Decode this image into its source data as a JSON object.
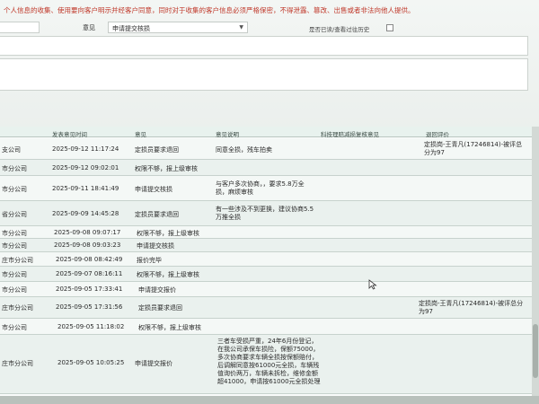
{
  "notice": "个人信息的收集、使用要向客户明示并经客户同意，同时对于收集的客户信息必须严格保密，不得泄露、篡改、出售或者非法向他人提供。",
  "filter": {
    "yijian_label": "意见",
    "yijian_value": "申请提交核损",
    "history_label": "是否已读/查看过往历史"
  },
  "table": {
    "headers": [
      "",
      "发表意见时间",
      "意见",
      "意见说明",
      "科技理赔减损复核意见",
      "退回评价"
    ],
    "rows": [
      {
        "org": "支公司",
        "time": "2025-09-12 11:17:24",
        "opinion": "定损员要求退回",
        "desc": "同意全损，残车拍卖",
        "review": "",
        "eval": "定损岗-王青凡(17246814)-被评总分为97"
      },
      {
        "org": "市分公司",
        "time": "2025-09-12 09:02:01",
        "opinion": "权限不够，报上级审核",
        "desc": "",
        "review": "",
        "eval": ""
      },
      {
        "org": "市分公司",
        "time": "2025-09-11 18:41:49",
        "opinion": "申请提交核损",
        "desc": "与客户多次协商，，要求5.8万全损，麻烦审核",
        "review": "",
        "eval": ""
      },
      {
        "org": "省分公司",
        "time": "2025-09-09 14:45:28",
        "opinion": "定损员要求退回",
        "desc": "有一些涉及不到更换，建议协商5.5万推全损",
        "review": "",
        "eval": ""
      },
      {
        "org": "市分公司",
        "time": "2025-09-08 09:07:17",
        "opinion": "权限不够，报上级审核",
        "desc": "",
        "review": "",
        "eval": ""
      },
      {
        "org": "市分公司",
        "time": "2025-09-08 09:03:23",
        "opinion": "申请提交核损",
        "desc": "",
        "review": "",
        "eval": ""
      },
      {
        "org": "庄市分公司",
        "time": "2025-09-08 08:42:49",
        "opinion": "报价完毕",
        "desc": "",
        "review": "",
        "eval": ""
      },
      {
        "org": "市分公司",
        "time": "2025-09-07 08:16:11",
        "opinion": "权限不够，报上级审核",
        "desc": "",
        "review": "",
        "eval": ""
      },
      {
        "org": "市分公司",
        "time": "2025-09-05 17:33:41",
        "opinion": "申请提交报价",
        "desc": "",
        "review": "",
        "eval": ""
      },
      {
        "org": "庄市分公司",
        "time": "2025-09-05 17:31:56",
        "opinion": "定损员要求退回",
        "desc": "",
        "review": "",
        "eval": "定损岗-王青凡(17246814)-被评总分为97"
      },
      {
        "org": "市分公司",
        "time": "2025-09-05 11:18:02",
        "opinion": "权限不够，报上级审核",
        "desc": "",
        "review": "",
        "eval": ""
      },
      {
        "org": "庄市分公司",
        "time": "2025-09-05 10:05:25",
        "opinion": "申请提交报价",
        "desc": "三者车受损严重，24年6月份登记，在我公司承保车损险，保额75000，多次协商要求车辆全损按保额赔付，后调解同意按61000元全损，车辆残值询价两万，车辆未拆检，维修金额超41000，申请按61000元全损处理",
        "review": "",
        "eval": ""
      }
    ]
  },
  "colors": {
    "notice": "#c0392b",
    "header_bg": "#e8f2ee"
  },
  "icons": {
    "cursor": "mouse-pointer-icon",
    "chevron": "chevron-down-icon"
  }
}
